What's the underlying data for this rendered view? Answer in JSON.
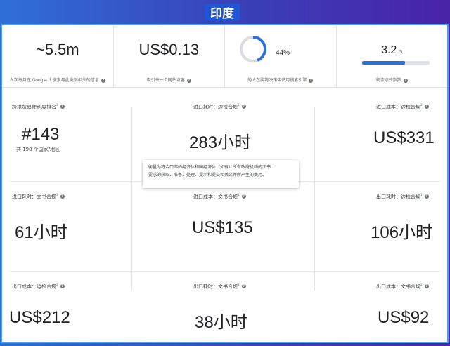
{
  "header": {
    "country": "印度"
  },
  "stats": [
    {
      "value": "~5.5m",
      "desc": "人次每月在 Google 上搜索与此类别相关的信息"
    },
    {
      "value": "US$0.13",
      "desc": "吸引来一个网站访客"
    },
    {
      "value": "44%",
      "percent": 44,
      "desc": "的人在购物决策中使用搜索引擎"
    },
    {
      "value": "3.2",
      "denominator": "/5",
      "score": 3.2,
      "max": 5,
      "desc": "物流绩效指数"
    }
  ],
  "metrics": [
    {
      "label": "跨境贸易便利度排名",
      "note": "1",
      "value": "#143",
      "sub": "共 190 个国家/地区"
    },
    {
      "label": "进口耗时：边检合规",
      "note": "1",
      "value": "283小时"
    },
    {
      "label": "进口成本：边检合规",
      "note": "2",
      "value": "US$331"
    },
    {
      "label": "进口耗时：文书合规",
      "note": "1",
      "value": "61小时"
    },
    {
      "label": "进口成本：文书合规",
      "note": "1",
      "value": "US$135"
    },
    {
      "label": "出口耗时：边检合规",
      "note": "1",
      "value": "106小时"
    },
    {
      "label": "出口成本：边检合规",
      "note": "2",
      "value": "US$212"
    },
    {
      "label": "出口耗时：文书合规",
      "note": "1",
      "value": "38小时"
    },
    {
      "label": "出口成本：文书合规",
      "note": "2",
      "value": "US$92"
    }
  ],
  "tooltip": {
    "line1": "衡量为符合口岸的经济体和国经济体（如有）所有政府机构的文书",
    "line2": "要求的获取、准备、处理、提示和提交相关文件所产生的费用。"
  },
  "info_icon": "info-icon",
  "colors": {
    "accent": "#2f6fd8",
    "panel_border": "#4aa3f0"
  }
}
